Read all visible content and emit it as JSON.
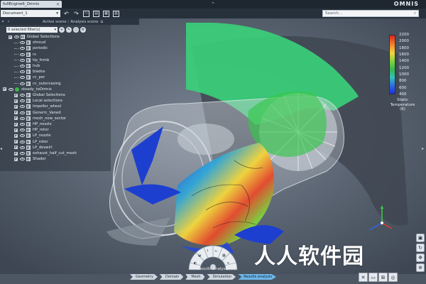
{
  "app": {
    "document_tab": "fullEngine6_Omnis",
    "brand": "OMNIS",
    "document_select": "Document_1",
    "search_placeholder": "Search..."
  },
  "scene": {
    "active_scene_label": "Active scene",
    "active_scene_value": "Analysis scene"
  },
  "panel": {
    "filter": "0 selected filter(s)",
    "tree": [
      {
        "label": "Global Selections",
        "indent": 0,
        "kind": "group"
      },
      {
        "label": "shroud",
        "indent": 1,
        "kind": "leaf"
      },
      {
        "label": "periodic",
        "indent": 1,
        "kind": "leaf"
      },
      {
        "label": "rs",
        "indent": 1,
        "kind": "leaf"
      },
      {
        "label": "tip_fnmb",
        "indent": 1,
        "kind": "leaf"
      },
      {
        "label": "hub",
        "indent": 1,
        "kind": "leaf"
      },
      {
        "label": "blades",
        "indent": 1,
        "kind": "leaf"
      },
      {
        "label": "cc_per",
        "indent": 1,
        "kind": "leaf"
      },
      {
        "label": "cc_outercasing",
        "indent": 1,
        "kind": "leaf"
      },
      {
        "label": "steady_toOmnis",
        "indent": 0,
        "kind": "root"
      },
      {
        "label": "Global Selections",
        "indent": 1,
        "kind": "item"
      },
      {
        "label": "Local selections",
        "indent": 1,
        "kind": "item"
      },
      {
        "label": "Impeller_wheel",
        "indent": 1,
        "kind": "item"
      },
      {
        "label": "Generic_Vaned",
        "indent": 1,
        "kind": "item"
      },
      {
        "label": "mesh_new_sector",
        "indent": 1,
        "kind": "item"
      },
      {
        "label": "HP_nozzle",
        "indent": 1,
        "kind": "item"
      },
      {
        "label": "HP_rotor",
        "indent": 1,
        "kind": "item"
      },
      {
        "label": "LP_nozzle",
        "indent": 1,
        "kind": "item"
      },
      {
        "label": "LP_rotor",
        "indent": 1,
        "kind": "item"
      },
      {
        "label": "LP_deswirl",
        "indent": 1,
        "kind": "item"
      },
      {
        "label": "exhaust_half_cut_mesh",
        "indent": 1,
        "kind": "item"
      },
      {
        "label": "Shader",
        "indent": 1,
        "kind": "item"
      }
    ]
  },
  "legend": {
    "ticks": [
      "2200",
      "2000",
      "1800",
      "1600",
      "1400",
      "1200",
      "1000",
      "800",
      "600",
      "400"
    ],
    "title_line1": "Static",
    "title_line2": "Temperature",
    "title_line3": "(K)",
    "colors": [
      "#e0211f",
      "#f2802a",
      "#f4d63a",
      "#7fd33d",
      "#37b64b",
      "#34c3b6",
      "#2c6ee5",
      "#1f2fd4"
    ]
  },
  "wheel": {
    "label": "Results analysis"
  },
  "workflow": {
    "steps": [
      "Geometry",
      "Domain",
      "Mesh",
      "Simulation",
      "Results analysis"
    ],
    "active_index": 4
  },
  "watermark": "人人软件园"
}
